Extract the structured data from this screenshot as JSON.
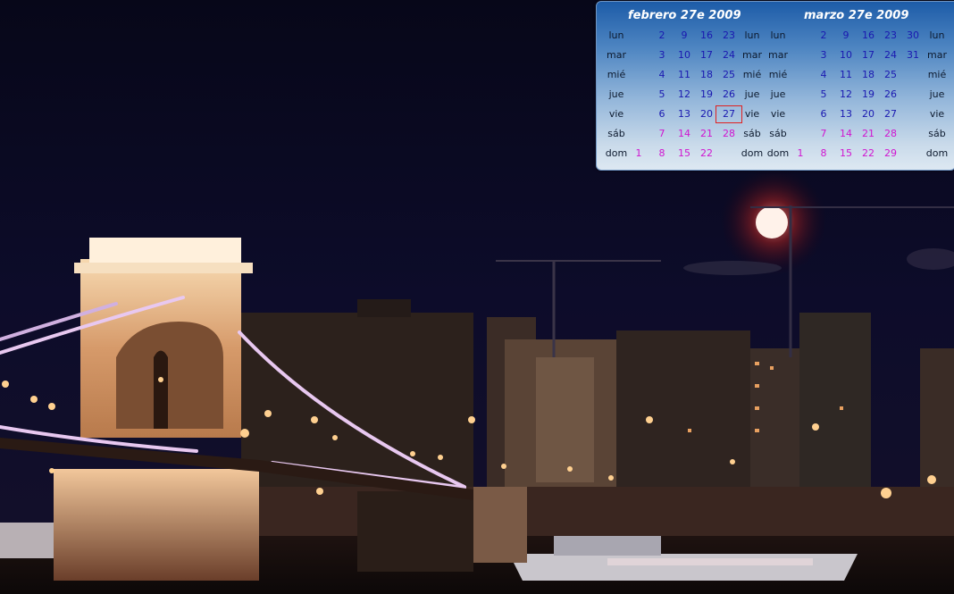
{
  "calendar": {
    "months": [
      {
        "title": "febrero 27e 2009",
        "weeks": [
          [
            null,
            "2",
            "9",
            "16",
            "23"
          ],
          [
            null,
            "3",
            "10",
            "17",
            "24"
          ],
          [
            null,
            "4",
            "11",
            "18",
            "25"
          ],
          [
            null,
            "5",
            "12",
            "19",
            "26"
          ],
          [
            null,
            "6",
            "13",
            "20",
            "27"
          ],
          [
            null,
            "7",
            "14",
            "21",
            "28"
          ],
          [
            "1",
            "8",
            "15",
            "22",
            null
          ]
        ],
        "today": "27"
      },
      {
        "title": "marzo 27e 2009",
        "weeks": [
          [
            null,
            "2",
            "9",
            "16",
            "23",
            "30"
          ],
          [
            null,
            "3",
            "10",
            "17",
            "24",
            "31"
          ],
          [
            null,
            "4",
            "11",
            "18",
            "25",
            null
          ],
          [
            null,
            "5",
            "12",
            "19",
            "26",
            null
          ],
          [
            null,
            "6",
            "13",
            "20",
            "27",
            null
          ],
          [
            null,
            "7",
            "14",
            "21",
            "28",
            null
          ],
          [
            "1",
            "8",
            "15",
            "22",
            "29",
            null
          ]
        ]
      }
    ],
    "day_names": [
      "lun",
      "mar",
      "mié",
      "jue",
      "vie",
      "sáb",
      "dom"
    ],
    "colors": {
      "weekday": "#1a18b0",
      "weekend": "#d014d0",
      "today_outline": "#e02020"
    }
  },
  "wallpaper": {
    "subject": "night-bridge-cityscape-photo"
  }
}
